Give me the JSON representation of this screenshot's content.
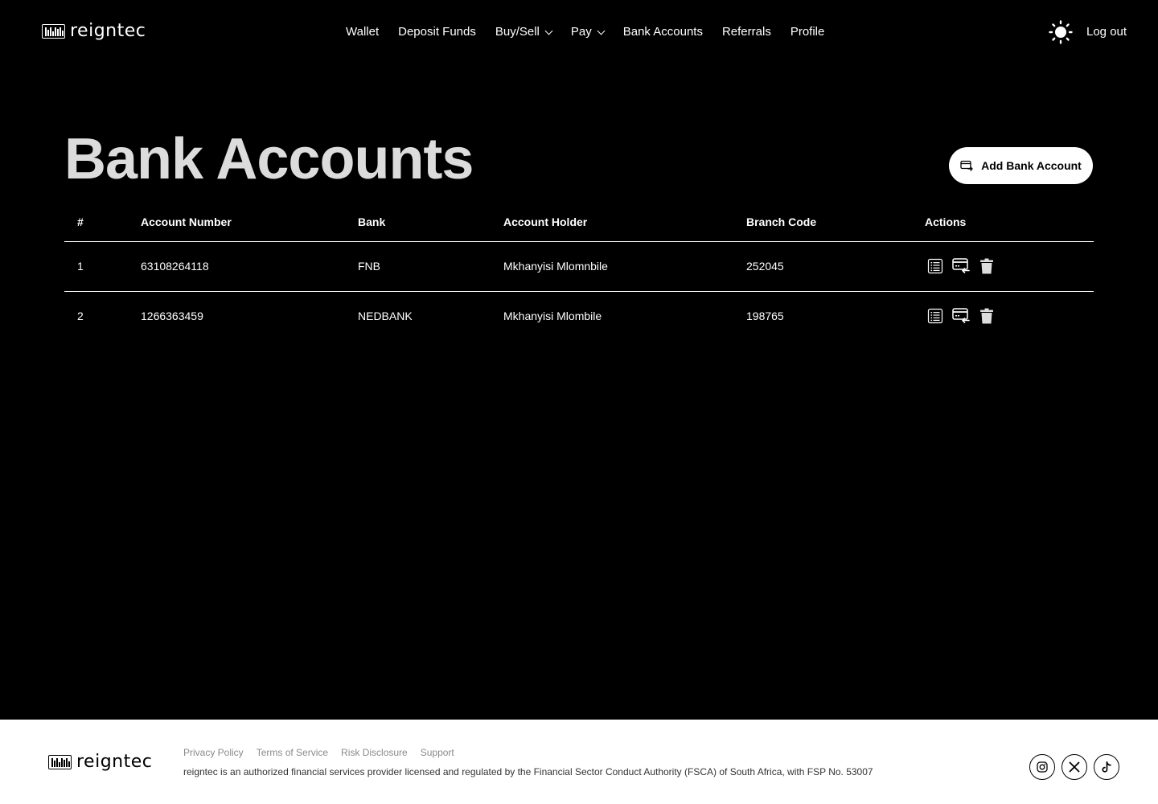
{
  "header": {
    "brand": "reigntec",
    "nav": [
      {
        "label": "Wallet",
        "dropdown": false
      },
      {
        "label": "Deposit Funds",
        "dropdown": false
      },
      {
        "label": "Buy/Sell",
        "dropdown": true
      },
      {
        "label": "Pay",
        "dropdown": true
      },
      {
        "label": "Bank Accounts",
        "dropdown": false
      },
      {
        "label": "Referrals",
        "dropdown": false
      },
      {
        "label": "Profile",
        "dropdown": false
      }
    ],
    "theme_icon": "sun-icon",
    "logout_label": "Log out"
  },
  "page": {
    "title": "Bank Accounts",
    "add_button_label": "Add Bank Account",
    "add_button_icon": "card-transfer-icon"
  },
  "table": {
    "headers": [
      "#",
      "Account Number",
      "Bank",
      "Account Holder",
      "Branch Code",
      "Actions"
    ],
    "rows": [
      {
        "index": "1",
        "account_number": "63108264118",
        "bank": "FNB",
        "holder": "Mkhanyisi Mlomnbile",
        "branch_code": "252045"
      },
      {
        "index": "2",
        "account_number": "1266363459",
        "bank": "NEDBANK",
        "holder": "Mkhanyisi Mlombile",
        "branch_code": "198765"
      }
    ],
    "action_icons": [
      "details-list-icon",
      "withdraw-card-icon",
      "trash-icon"
    ]
  },
  "footer": {
    "brand": "reigntec",
    "links": [
      "Privacy Policy",
      "Terms of Service",
      "Risk Disclosure",
      "Support"
    ],
    "legal": "reigntec is an authorized financial services provider licensed and regulated by the Financial Sector Conduct Authority (FSCA) of South Africa, with FSP No. 53007",
    "socials": [
      "instagram-icon",
      "x-icon",
      "tiktok-icon"
    ]
  },
  "colors": {
    "background": "#000000",
    "text": "#ffffff",
    "title": "#dcdcdc",
    "footer_bg": "#ffffff",
    "footer_link": "#8a8a8a"
  }
}
